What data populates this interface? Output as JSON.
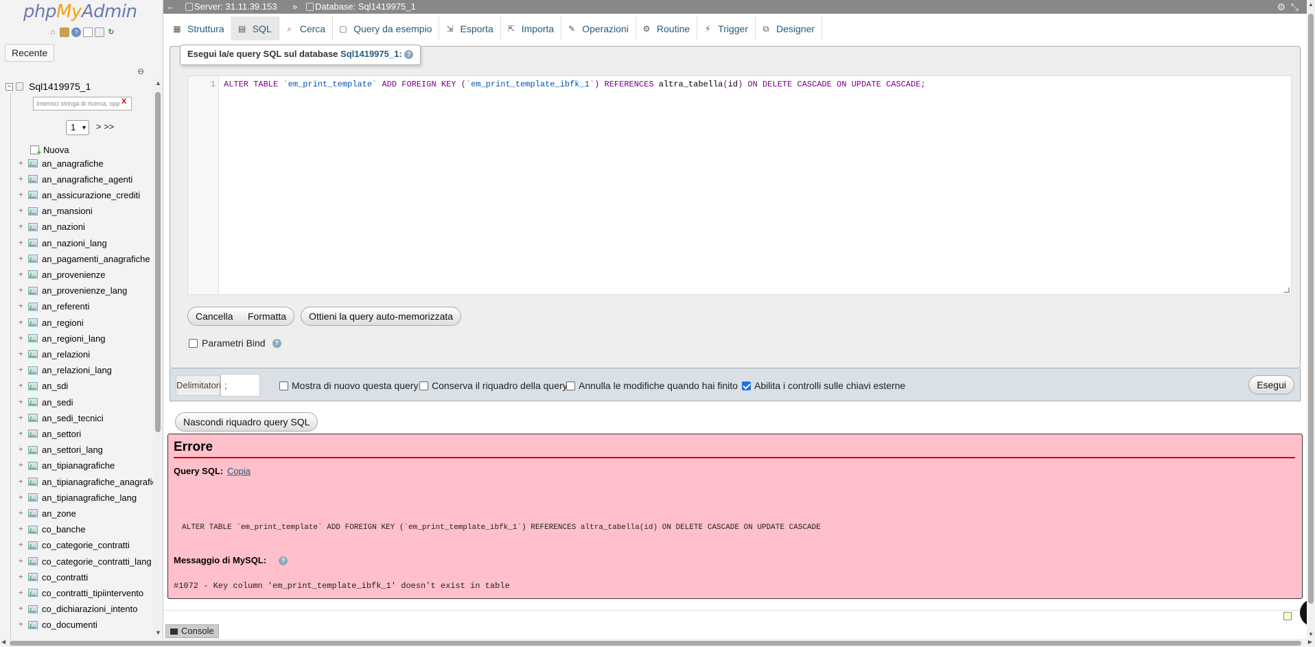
{
  "logo": {
    "php": "php",
    "my": "My",
    "admin": "Admin"
  },
  "nav": {
    "recent_label": "Recente",
    "db_name": "Sql1419975_1",
    "filter_placeholder": "Inserisci stringa di ricerca, opp",
    "filter_clear": "X",
    "page_value": "1",
    "page_next": "> >>",
    "new_label": "Nuova",
    "tables": [
      "an_anagrafiche",
      "an_anagrafiche_agenti",
      "an_assicurazione_crediti",
      "an_mansioni",
      "an_nazioni",
      "an_nazioni_lang",
      "an_pagamenti_anagrafiche",
      "an_provenienze",
      "an_provenienze_lang",
      "an_referenti",
      "an_regioni",
      "an_regioni_lang",
      "an_relazioni",
      "an_relazioni_lang",
      "an_sdi",
      "an_sedi",
      "an_sedi_tecnici",
      "an_settori",
      "an_settori_lang",
      "an_tipianagrafiche",
      "an_tipianagrafiche_anagrafiche",
      "an_tipianagrafiche_lang",
      "an_zone",
      "co_banche",
      "co_categorie_contratti",
      "co_categorie_contratti_lang",
      "co_contratti",
      "co_contratti_tipiintervento",
      "co_dichiarazioni_intento",
      "co_documenti"
    ]
  },
  "topbar": {
    "back": "←",
    "server": "Server: 31.11.39.153",
    "separator": "»",
    "database": "Database: Sql1419975_1",
    "settings_icon": "gear-icon",
    "collapse_icon": "collapse-icon"
  },
  "tabs": [
    {
      "label": "Struttura",
      "icon": "structure-icon"
    },
    {
      "label": "SQL",
      "icon": "sql-icon"
    },
    {
      "label": "Cerca",
      "icon": "search-icon"
    },
    {
      "label": "Query da esempio",
      "icon": "query-icon"
    },
    {
      "label": "Esporta",
      "icon": "export-icon"
    },
    {
      "label": "Importa",
      "icon": "import-icon"
    },
    {
      "label": "Operazioni",
      "icon": "wrench-icon"
    },
    {
      "label": "Routine",
      "icon": "routine-icon"
    },
    {
      "label": "Trigger",
      "icon": "trigger-icon"
    },
    {
      "label": "Designer",
      "icon": "designer-icon"
    }
  ],
  "sql_panel": {
    "legend_prefix": "Esegui la/e query SQL sul database",
    "legend_db": "Sql1419975_1:",
    "line_number": "1",
    "code": {
      "p1": "ALTER TABLE ",
      "p2": "`em_print_template`",
      "p3": " ADD FOREIGN KEY (",
      "p4": "`em_print_template_ibfk_1`",
      "p5": ") REFERENCES ",
      "p6": "altra_tabella",
      "p7": "(",
      "p8": "id",
      "p9": ") ON DELETE CASCADE ON UPDATE CASCADE;"
    },
    "buttons": {
      "clear": "Cancella",
      "format": "Formatta",
      "get_autosaved": "Ottieni la query auto-memorizzata"
    },
    "bind_params_label": "Parametri Bind",
    "bind_params_checked": false
  },
  "options": {
    "delimiter_label": "Delimitatori",
    "delimiter_value": ";",
    "show_again": {
      "label": "Mostra di nuovo questa query",
      "checked": false
    },
    "retain_box": {
      "label": "Conserva il riquadro della query",
      "checked": false
    },
    "rollback": {
      "label": "Annulla le modifiche quando hai finito",
      "checked": false
    },
    "fk_checks": {
      "label": "Abilita i controlli sulle chiavi esterne",
      "checked": true
    },
    "execute": "Esegui"
  },
  "hide_query_box": "Nascondi riquadro query SQL",
  "error": {
    "title": "Errore",
    "query_label": "Query SQL:",
    "copy_link": "Copia",
    "query": "ALTER TABLE `em_print_template` ADD FOREIGN KEY (`em_print_template_ibfk_1`) REFERENCES altra_tabella(id) ON DELETE CASCADE ON UPDATE CASCADE",
    "mysql_label": "Messaggio di MySQL:",
    "message": "#1072 - Key column 'em_print_template_ibfk_1' doesn't exist in table",
    "bg_color": "#ffc0cb"
  },
  "console_label": "Console",
  "colors": {
    "link": "#235a81",
    "logo_php": "#6c78af",
    "logo_my": "#f89c0e",
    "error_rule": "#cc0000"
  }
}
